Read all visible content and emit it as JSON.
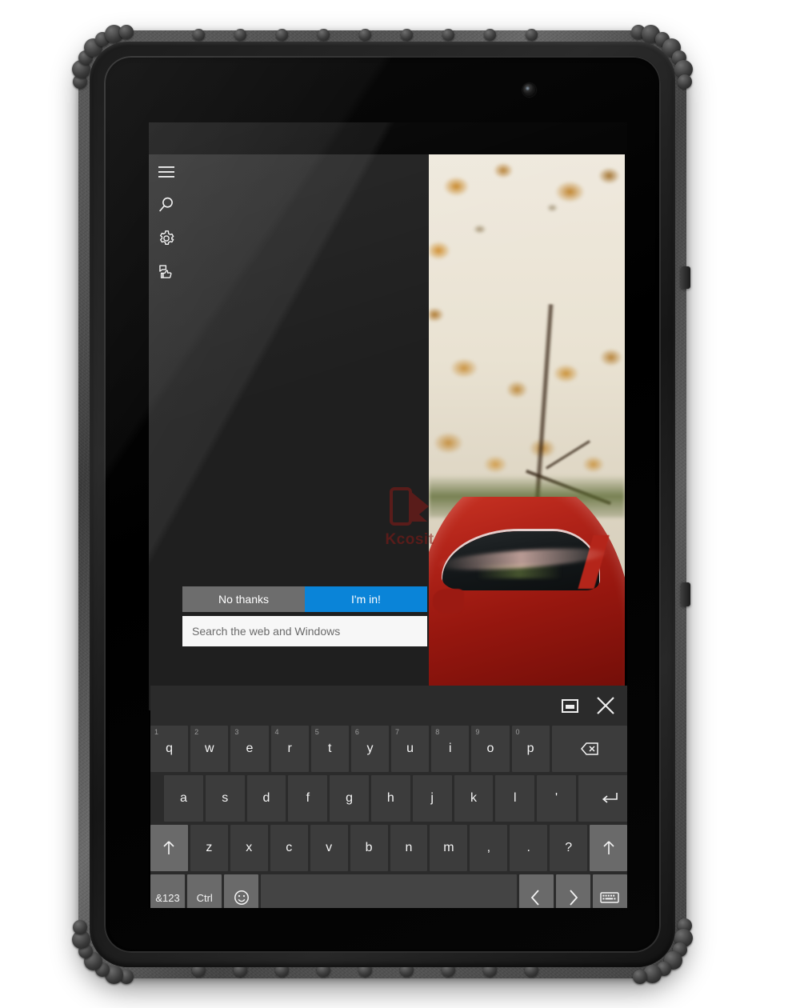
{
  "device": {
    "name": "rugged-tablet",
    "camera_label": "front-camera",
    "side_buttons": [
      "power-button",
      "volume-button"
    ]
  },
  "screen": {
    "wallpaper_description": "autumn-tree-and-red-sports-car",
    "watermark": {
      "brand": "Kcosit",
      "color": "#8a1a16"
    }
  },
  "cortana": {
    "rail_items": [
      {
        "name": "hamburger-menu-icon",
        "label": "Menu"
      },
      {
        "name": "search-icon",
        "label": "Search"
      },
      {
        "name": "gear-icon",
        "label": "Settings"
      },
      {
        "name": "feedback-icon",
        "label": "Feedback"
      }
    ],
    "prompt": {
      "decline_label": "No thanks",
      "accept_label": "I'm in!",
      "decline_color": "#6d6d6d",
      "accept_color": "#0a84d8"
    },
    "search": {
      "placeholder": "Search the web and Windows",
      "value": ""
    }
  },
  "keyboard": {
    "title_bar": {
      "dock_label": "dock-keyboard",
      "close_label": "close-keyboard"
    },
    "rows": [
      {
        "name": "row-top",
        "keys": [
          {
            "label": "q",
            "num": "1"
          },
          {
            "label": "w",
            "num": "2"
          },
          {
            "label": "e",
            "num": "3"
          },
          {
            "label": "r",
            "num": "4"
          },
          {
            "label": "t",
            "num": "5"
          },
          {
            "label": "y",
            "num": "6"
          },
          {
            "label": "u",
            "num": "7"
          },
          {
            "label": "i",
            "num": "8"
          },
          {
            "label": "o",
            "num": "9"
          },
          {
            "label": "p",
            "num": "0"
          },
          {
            "label": "",
            "num": "",
            "icon": "backspace-icon",
            "wide": 2.0
          }
        ]
      },
      {
        "name": "row-home",
        "keys": [
          {
            "label": "a"
          },
          {
            "label": "s"
          },
          {
            "label": "d"
          },
          {
            "label": "f"
          },
          {
            "label": "g"
          },
          {
            "label": "h"
          },
          {
            "label": "j"
          },
          {
            "label": "k"
          },
          {
            "label": "l"
          },
          {
            "label": "'"
          },
          {
            "label": "",
            "icon": "enter-icon",
            "wide": 1.6
          }
        ]
      },
      {
        "name": "row-bottom",
        "keys": [
          {
            "label": "",
            "icon": "shift-icon",
            "fn": true
          },
          {
            "label": "z"
          },
          {
            "label": "x"
          },
          {
            "label": "c"
          },
          {
            "label": "v"
          },
          {
            "label": "b"
          },
          {
            "label": "n"
          },
          {
            "label": "m"
          },
          {
            "label": ","
          },
          {
            "label": "."
          },
          {
            "label": "?"
          },
          {
            "label": "",
            "icon": "shift-icon",
            "fn": true
          }
        ]
      },
      {
        "name": "row-function",
        "keys": [
          {
            "label": "&123",
            "fn": true
          },
          {
            "label": "Ctrl",
            "fn": true
          },
          {
            "label": "",
            "icon": "emoji-icon",
            "fn": true
          },
          {
            "label": "",
            "name": "spacebar",
            "space": true,
            "wide": 7.4
          },
          {
            "label": "",
            "icon": "arrow-left-icon",
            "fn": true
          },
          {
            "label": "",
            "icon": "arrow-right-icon",
            "fn": true
          },
          {
            "label": "",
            "icon": "keyboard-layout-icon",
            "fn": true
          }
        ]
      }
    ]
  }
}
